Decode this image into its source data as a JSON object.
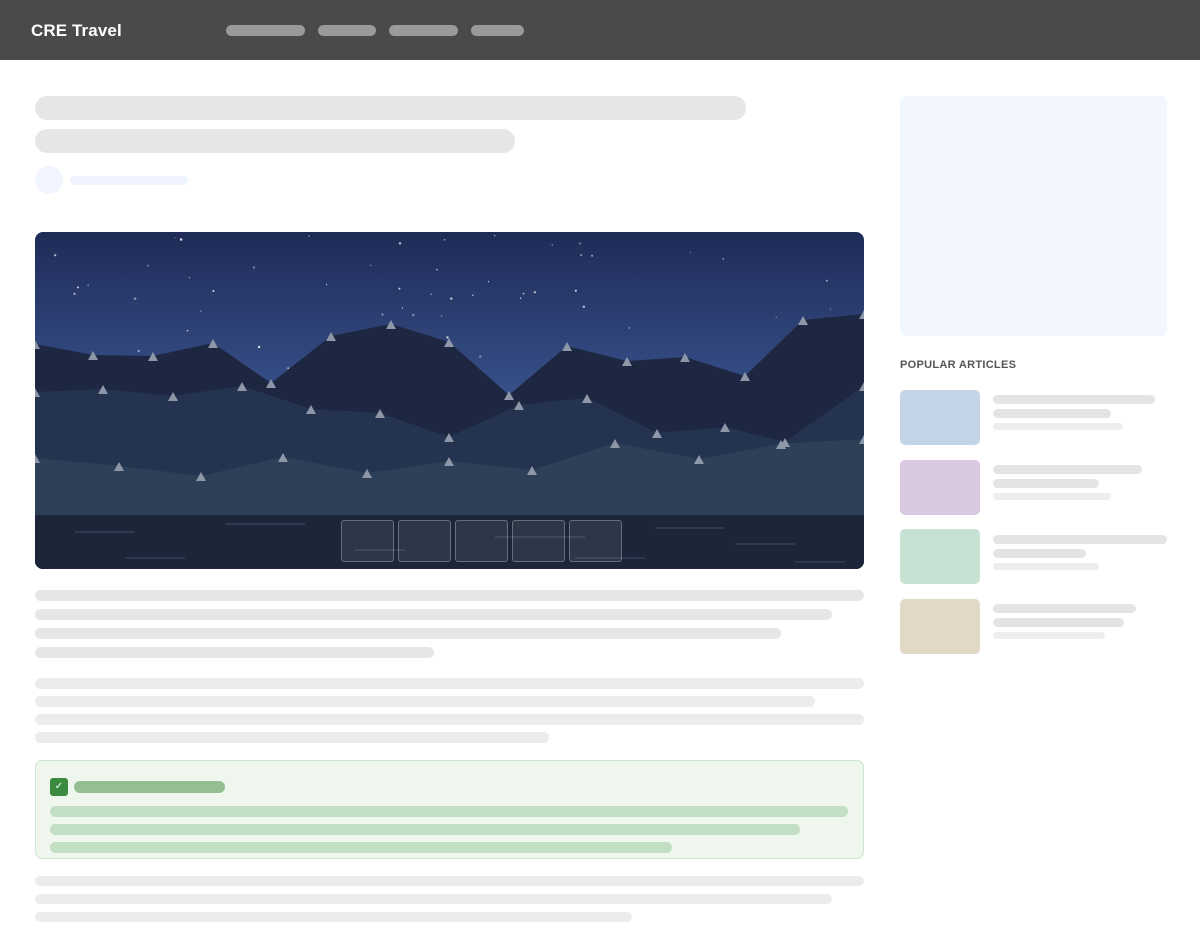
{
  "header": {
    "brand": "CRE Travel"
  },
  "sidebar": {
    "popular_title": "POPULAR ARTICLES"
  },
  "callout": {
    "icon": "check-icon",
    "icon_glyph": "✓"
  },
  "colors": {
    "header_bg": "#4a4a4a",
    "callout_bg": "#eef6ee",
    "callout_accent": "#3a8a3f",
    "ad_bg": "#f1f6ff",
    "popular_thumb_1": "#c5d5e8",
    "popular_thumb_2": "#dac7e0",
    "popular_thumb_3": "#c7e2d3",
    "popular_thumb_4": "#e1d8c6"
  }
}
